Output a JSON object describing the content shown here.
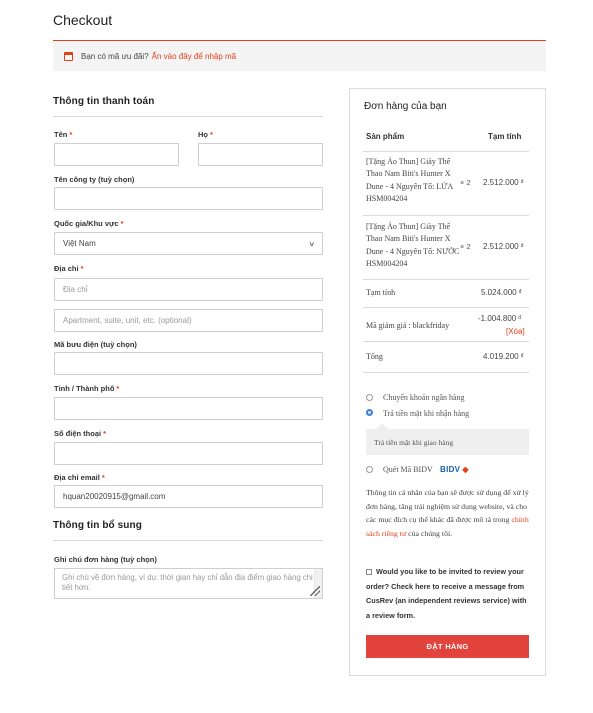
{
  "page": {
    "title": "Checkout"
  },
  "coupon": {
    "text": "Bạn có mã ưu đãi?",
    "link": "Ấn vào đây để nhập mã"
  },
  "billing": {
    "title": "Thông tin thanh toán",
    "first_name": {
      "label": "Tên",
      "value": ""
    },
    "last_name": {
      "label": "Họ",
      "value": ""
    },
    "company": {
      "label": "Tên công ty (tuỳ chọn)",
      "value": ""
    },
    "country": {
      "label": "Quốc gia/Khu vực",
      "value": "Việt Nam"
    },
    "address": {
      "label": "Địa chỉ",
      "placeholder": "Địa chỉ",
      "placeholder2": "Apartment, suite, unit, etc. (optional)"
    },
    "postcode": {
      "label": "Mã bưu điện (tuỳ chọn)",
      "value": ""
    },
    "city": {
      "label": "Tỉnh / Thành phố",
      "value": ""
    },
    "phone": {
      "label": "Số điện thoại",
      "value": ""
    },
    "email": {
      "label": "Địa chỉ email",
      "value": "hquan20020915@gmail.com"
    },
    "required_mark": "*"
  },
  "additional": {
    "title": "Thông tin bổ sung",
    "notes_label": "Ghi chú đơn hàng (tuỳ chọn)",
    "notes_placeholder": "Ghi chú về đơn hàng, ví dụ: thời gian hay chỉ dẫn địa điểm giao hàng chi tiết hơn."
  },
  "order": {
    "title": "Đơn hàng của bạn",
    "col_product": "Sản phẩm",
    "col_subtotal": "Tạm tính",
    "items": [
      {
        "name": "[Tặng Áo Thun] Giày Thể Thao Nam Biti's Hunter X Dune - 4 Nguyên Tố: LỬA HSM004204",
        "qty": "× 2",
        "price": "2.512.000",
        "currency": "đ"
      },
      {
        "name": "[Tặng Áo Thun] Giày Thể Thao Nam Biti's Hunter X Dune - 4 Nguyên Tố: NƯỚC HSM004204",
        "qty": "× 2",
        "price": "2.512.000",
        "currency": "đ"
      }
    ],
    "subtotal_label": "Tạm tính",
    "subtotal_value": "5.024.000",
    "discount_label": "Mã giảm giá : blackfriday",
    "discount_value": "-1.004.800",
    "remove_label": "[Xóa]",
    "total_label": "Tổng",
    "total_value": "4.019.200",
    "currency": "đ"
  },
  "payment": {
    "bank_transfer": "Chuyển khoản ngân hàng",
    "cod": "Trả tiền mặt khi nhận hàng",
    "cod_desc": "Trả tiền mặt khi giao hàng",
    "qr_bidv": "Quét Mã BIDV",
    "bidv_logo": "BIDV",
    "privacy_text": "Thông tin cá nhân của bạn sẽ được sử dụng để xử lý đơn hàng, tăng trải nghiệm sử dụng website, và cho các mục đích cụ thể khác đã được mô tả trong",
    "privacy_link": "chính sách riêng tư",
    "privacy_tail": "của chúng tôi.",
    "review_opt_in": "Would you like to be invited to review your order? Check here to receive a message from CusRev (an independent reviews service) with a review form.",
    "place_order": "ĐẶT HÀNG"
  }
}
